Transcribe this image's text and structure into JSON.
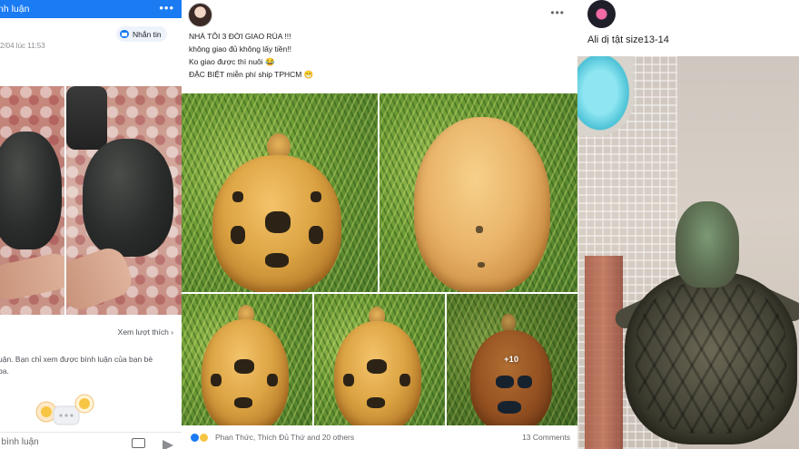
{
  "panel1": {
    "header_title": "nh luận",
    "header_menu": "•••",
    "date": "2/04 lúc 11:53",
    "message_button": "Nhắn tin",
    "see_likes": "Xem lượt thích ›",
    "comment_notice_line1": "uận. Bạn chỉ xem được bình luận của bạn bè",
    "comment_notice_line2": "ba.",
    "comment_placeholder": "t bình luận",
    "icons": [
      "chat-bubble-icon",
      "photo-icon",
      "send-icon"
    ],
    "accent_color": "#1a7bf3"
  },
  "panel2": {
    "post_lines": [
      "NHÀ TÔI 3 ĐỜI GIAO RÙA !!!",
      "không giao đủ không lấy tiền!!",
      "Ko giao được thì nuôi 😂",
      "ĐẶC BIỆT miễn phí ship TPHCM 😁"
    ],
    "menu": "•••",
    "more_photos": "+10",
    "reactions_text": "Phan Thức, Thích Đủ Thứ and 20 others",
    "comments_count": "13 Comments",
    "reaction_icons": [
      "like-icon",
      "haha-icon"
    ]
  },
  "panel3": {
    "caption": "Ali dị tật size13-14"
  }
}
